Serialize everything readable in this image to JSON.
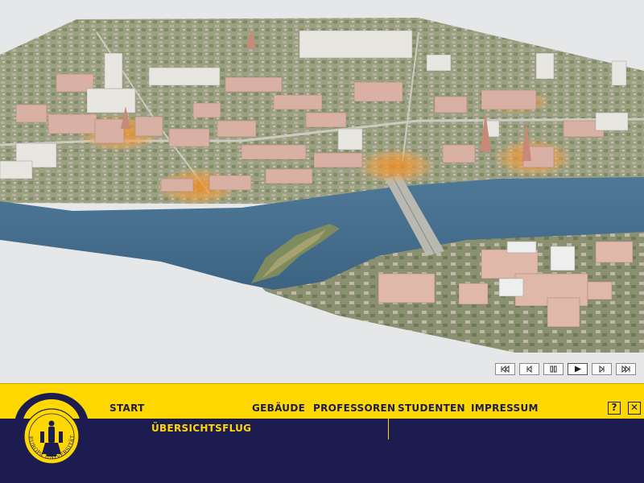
{
  "nav": {
    "start": "START",
    "gebaeude": "GEBÄUDE",
    "professoren": "PROFESSOREN",
    "studenten": "STUDENTEN",
    "impressum": "IMPRESSUM",
    "uebersichtsflug": "ÜBERSICHTSFLUG"
  },
  "buttons": {
    "help": "?",
    "close": "✕"
  },
  "seal": {
    "text": "EUROPA UNIVERSITÄT VIADRINA"
  },
  "player": {
    "controls": [
      "skip-back",
      "step-back",
      "pause",
      "play",
      "step-forward",
      "skip-forward"
    ],
    "active": "play"
  },
  "colors": {
    "nav_yellow": "#ffd800",
    "nav_navy": "#1c1c50",
    "highlight_orange": "#f0a040",
    "river": "#4a6e8a"
  },
  "map": {
    "description_icon": "aerial-3d-city-map"
  }
}
